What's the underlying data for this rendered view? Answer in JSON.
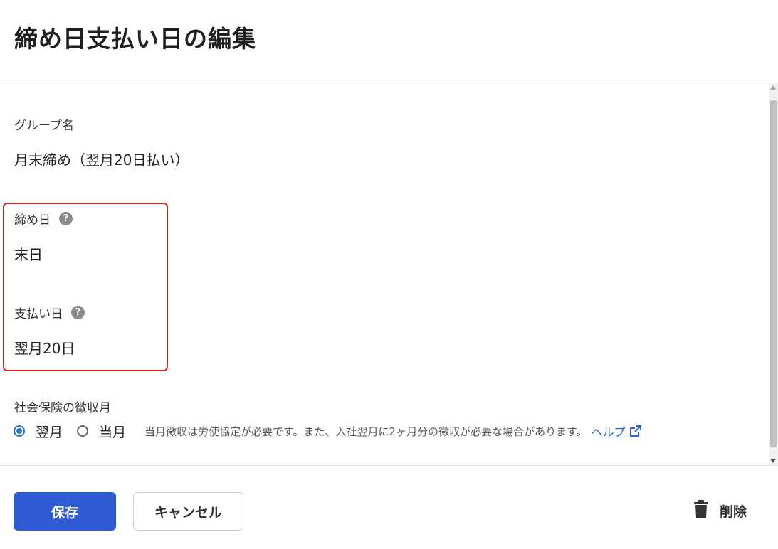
{
  "page": {
    "title": "締め日支払い日の編集"
  },
  "group": {
    "label": "グループ名",
    "value": "月末締め（翌月20日払い）"
  },
  "closing": {
    "label": "締め日",
    "value": "末日"
  },
  "payment": {
    "label": "支払い日",
    "value": "翌月20日"
  },
  "insurance": {
    "label": "社会保険の徴収月",
    "options": [
      {
        "label": "翌月",
        "checked": true
      },
      {
        "label": "当月",
        "checked": false
      }
    ],
    "note": "当月徴収は労使協定が必要です。また、入社翌月に2ヶ月分の徴収が必要な場合があります。",
    "help_link": "ヘルプ"
  },
  "footer": {
    "save_label": "保存",
    "cancel_label": "キャンセル",
    "delete_label": "削除"
  },
  "colors": {
    "primary": "#2f5bd3",
    "highlight": "#e0211f",
    "link": "#2b5fcf"
  }
}
